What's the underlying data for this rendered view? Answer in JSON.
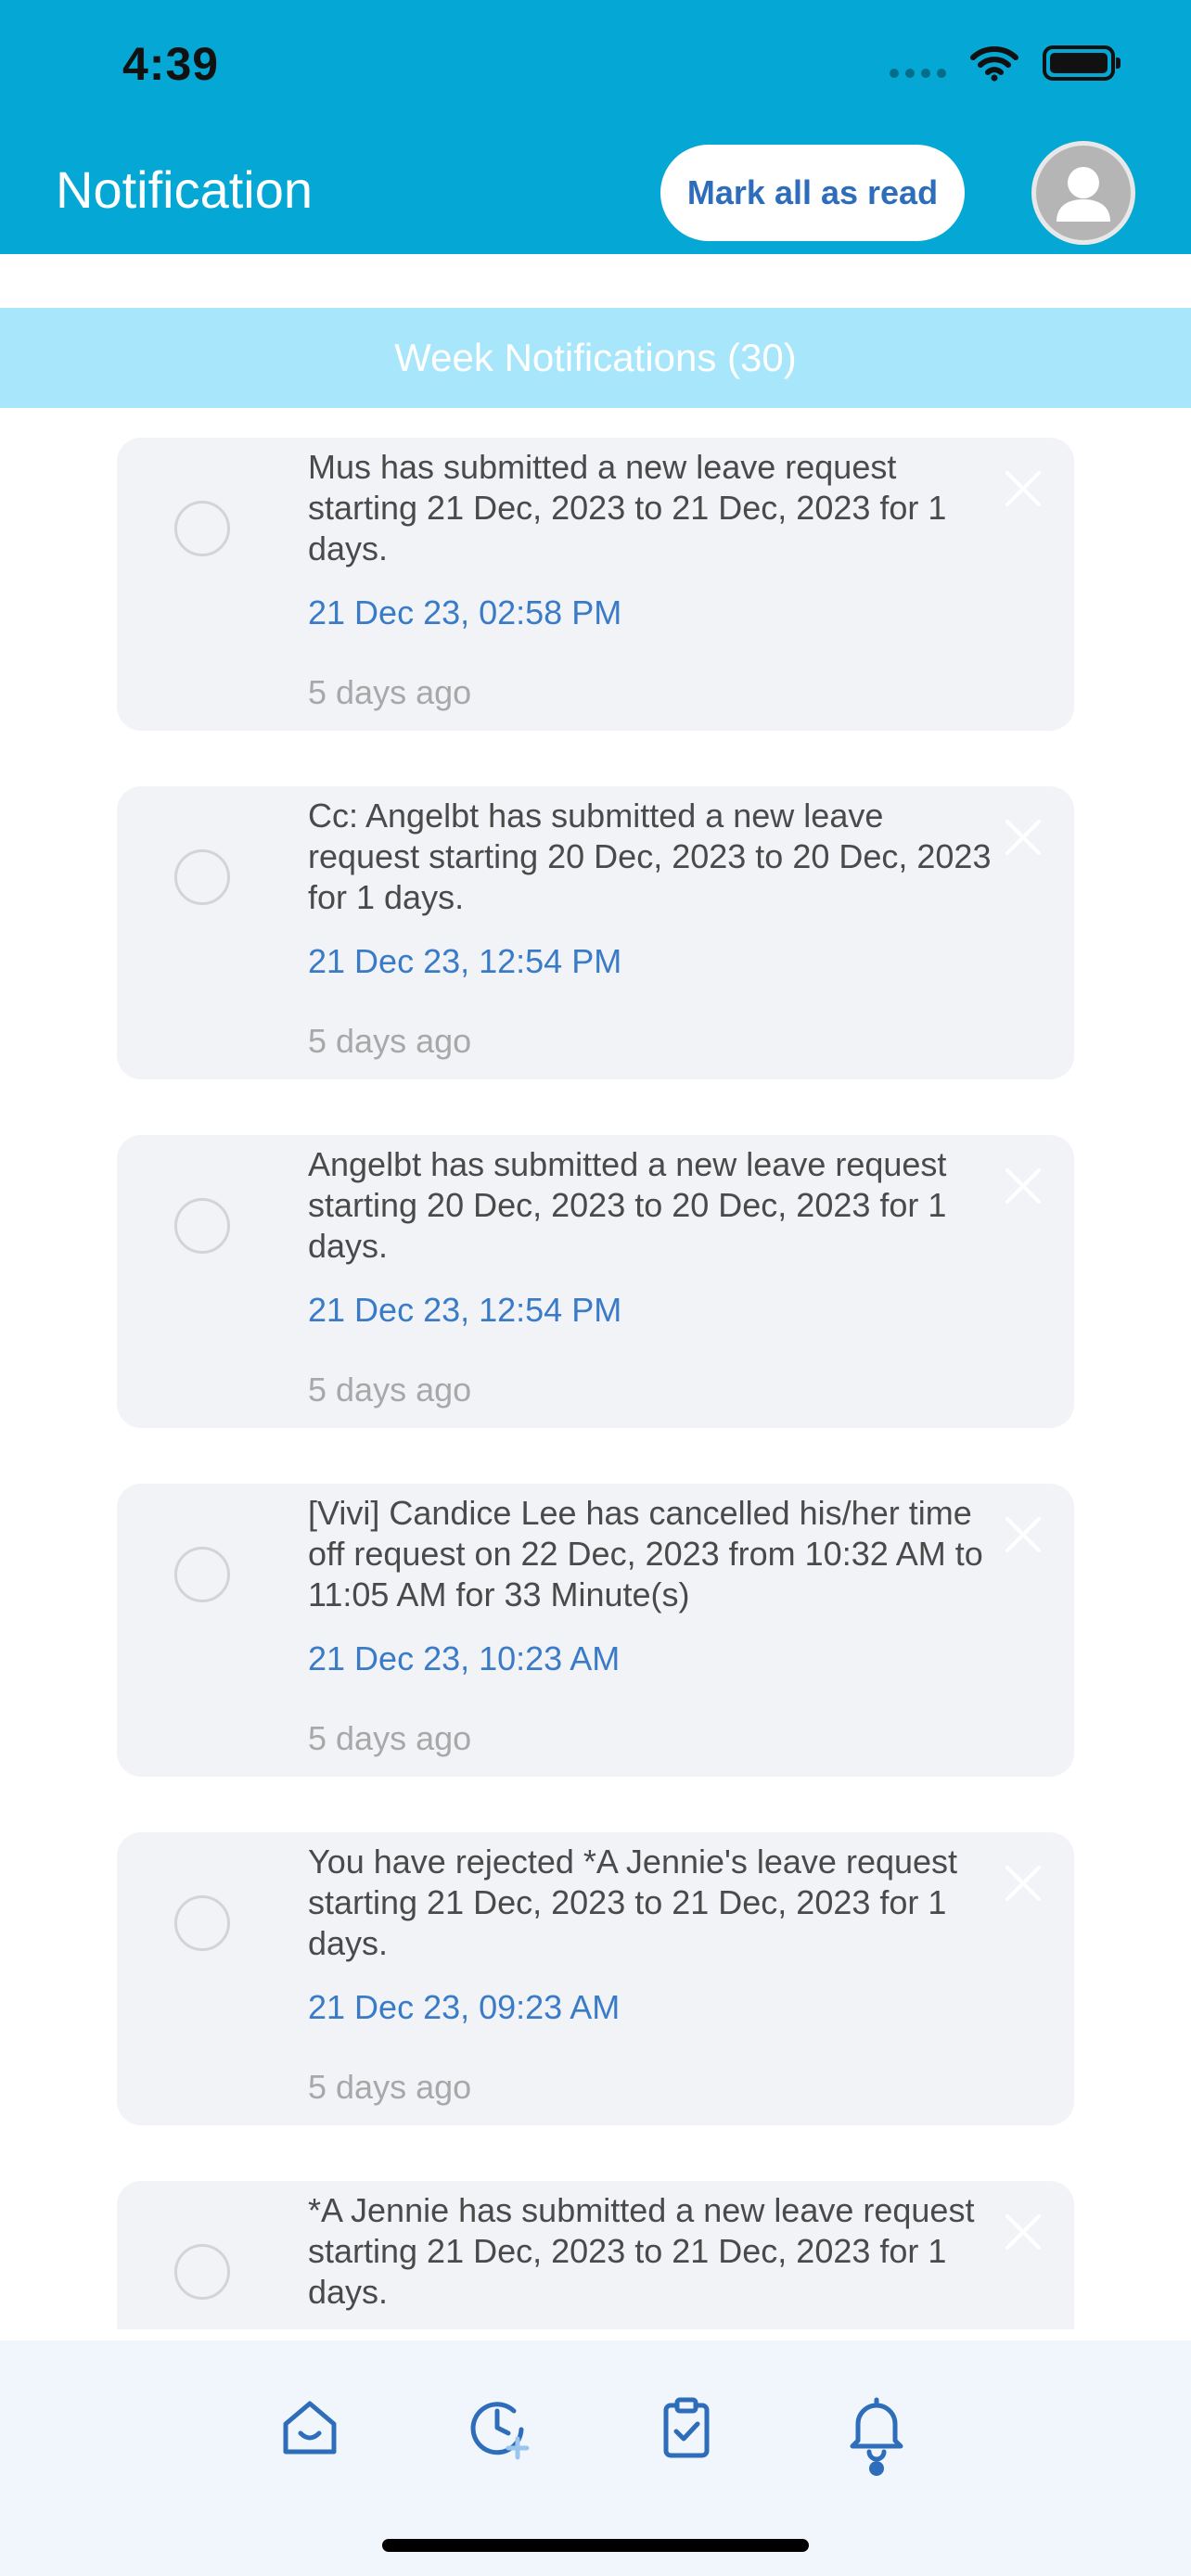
{
  "status_bar": {
    "time": "4:39"
  },
  "header": {
    "title": "Notification",
    "mark_all_label": "Mark all as read"
  },
  "section": {
    "title": "Week Notifications (30)"
  },
  "notifications": [
    {
      "message": "Mus has submitted a new leave request starting 21 Dec, 2023 to 21 Dec, 2023 for 1 days.",
      "timestamp": "21 Dec 23, 02:58 PM",
      "relative": "5 days ago"
    },
    {
      "message": "Cc: Angelbt has submitted a new leave request starting 20 Dec, 2023 to 20 Dec, 2023 for 1 days.",
      "timestamp": "21 Dec 23, 12:54 PM",
      "relative": "5 days ago"
    },
    {
      "message": "Angelbt has submitted a new leave request starting 20 Dec, 2023 to 20 Dec, 2023 for 1 days.",
      "timestamp": "21 Dec 23, 12:54 PM",
      "relative": "5 days ago"
    },
    {
      "message": "[Vivi] Candice Lee has cancelled his/her time off request on 22 Dec, 2023 from 10:32 AM to 11:05 AM for 33 Minute(s)",
      "timestamp": "21 Dec 23, 10:23 AM",
      "relative": "5 days ago"
    },
    {
      "message": "You have rejected *A Jennie's leave request starting 21 Dec, 2023 to 21 Dec, 2023 for 1 days.",
      "timestamp": "21 Dec 23, 09:23 AM",
      "relative": "5 days ago"
    },
    {
      "message": "*A Jennie has submitted a new leave request starting 21 Dec, 2023 to 21 Dec, 2023 for 1 days.",
      "timestamp": "",
      "relative": ""
    }
  ],
  "tabbar": {
    "tabs": [
      {
        "icon": "home-icon"
      },
      {
        "icon": "clock-add-icon"
      },
      {
        "icon": "clipboard-check-icon"
      },
      {
        "icon": "bell-icon",
        "active": true
      }
    ]
  },
  "colors": {
    "header_bg": "#05a8d4",
    "banner_bg": "#a8e6fb",
    "card_bg": "#f1f3f7",
    "accent": "#2d6db9",
    "timestamp": "#3a7bc8"
  }
}
